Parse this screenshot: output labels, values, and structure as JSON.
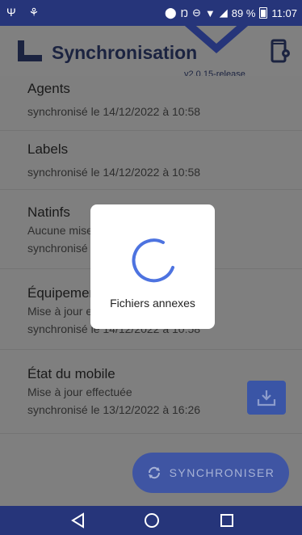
{
  "status_bar": {
    "battery_text": "89 %",
    "time": "11:07"
  },
  "header": {
    "title": "Synchronisation",
    "version": "v2.0.15-release"
  },
  "items": [
    {
      "name": "Agents",
      "lines": [
        "synchronisé le 14/12/2022 à 10:58"
      ]
    },
    {
      "name": "Labels",
      "lines": [
        "synchronisé le 14/12/2022 à 10:58"
      ]
    },
    {
      "name": "Natinfs",
      "lines": [
        "Aucune mise",
        "synchronisé"
      ]
    },
    {
      "name": "Équipemen",
      "lines": [
        "Mise à jour e",
        "synchronisé le 14/12/2022 à 10:58"
      ]
    },
    {
      "name": "État du mobile",
      "lines": [
        "Mise à jour effectuée",
        "synchronisé le 13/12/2022 à 16:26"
      ]
    }
  ],
  "sync_button": {
    "label": "SYNCHRONISER"
  },
  "dialog": {
    "label": "Fichiers annexes"
  },
  "colors": {
    "primary": "#3f55a3",
    "statusbar": "#26357a",
    "spinner": "#4d73e0"
  }
}
